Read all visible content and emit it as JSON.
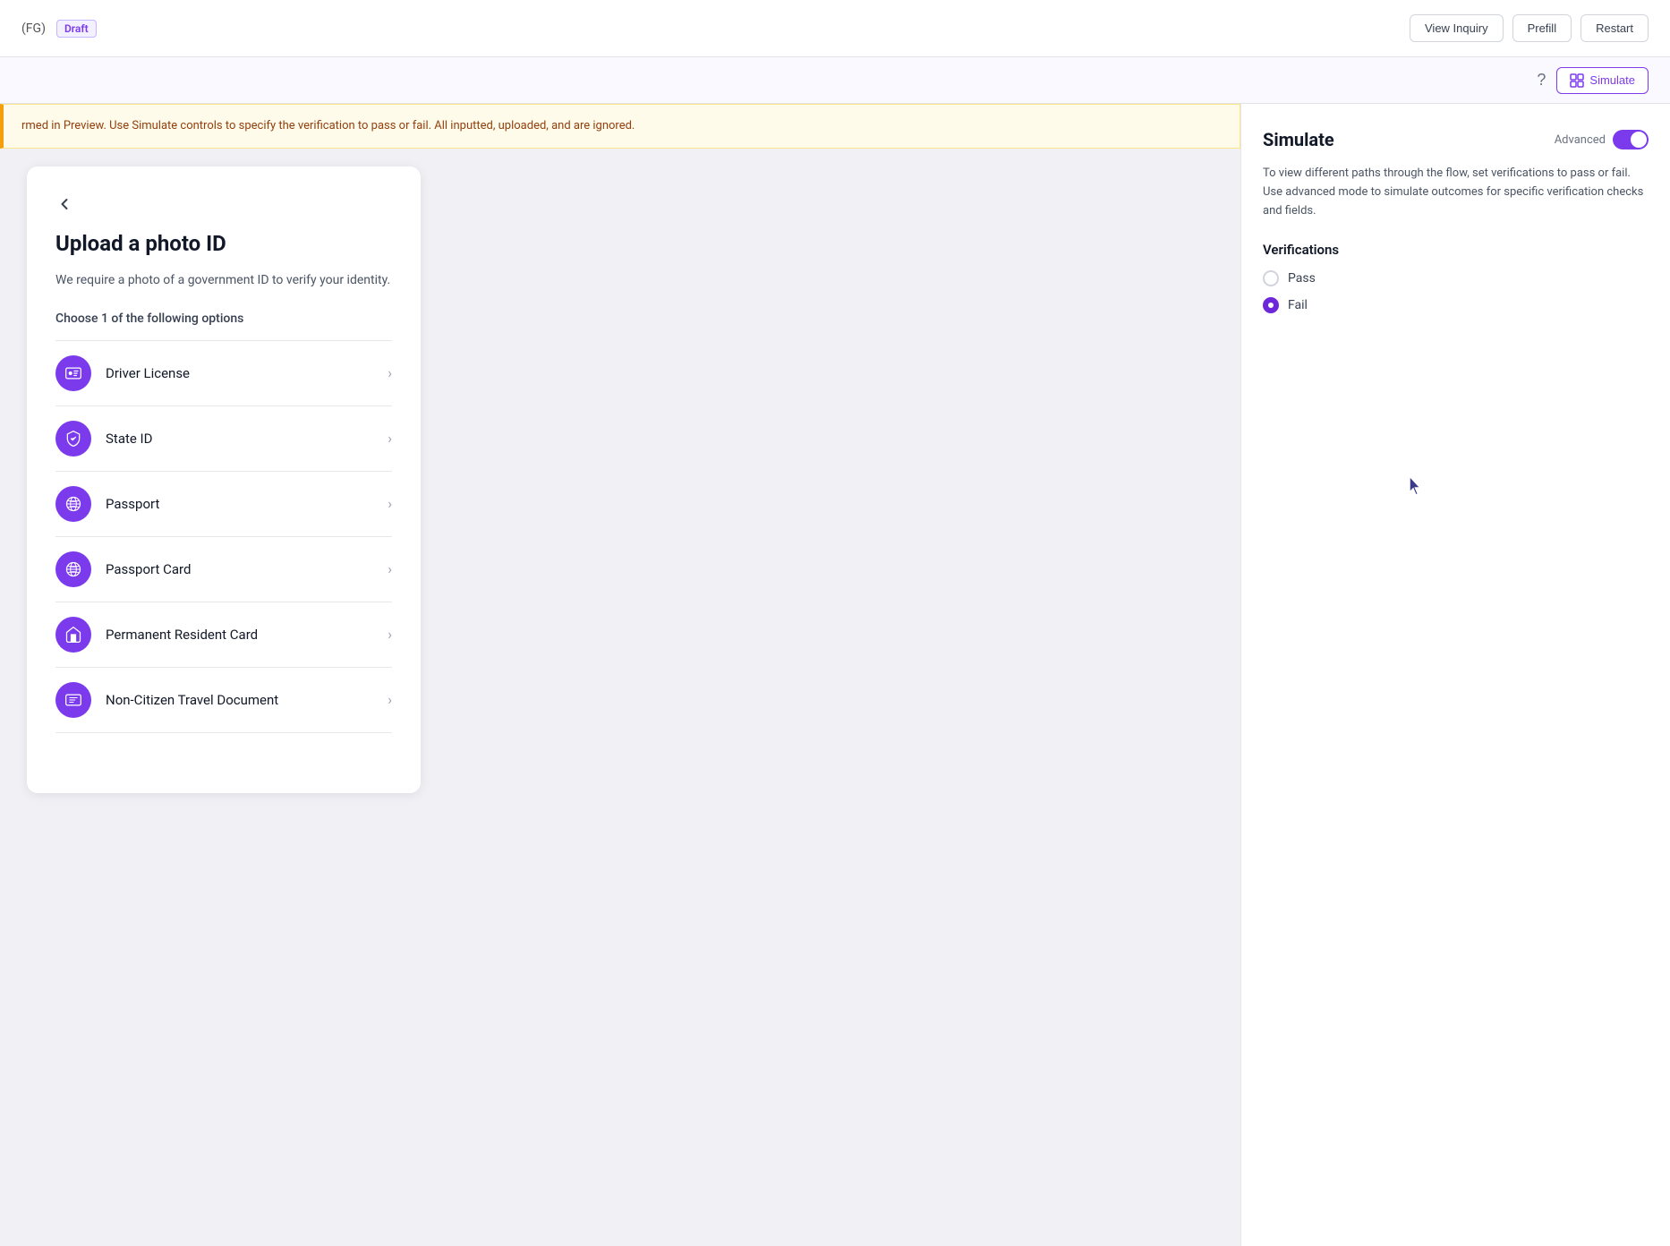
{
  "header": {
    "title": "(FG)",
    "draft_label": "Draft",
    "view_inquiry_label": "View Inquiry",
    "prefill_label": "Prefill",
    "restart_label": "Restart"
  },
  "toolbar": {
    "simulate_label": "Simulate",
    "help_icon": "?"
  },
  "warning": {
    "text": "rmed in Preview. Use Simulate controls to specify the verification to pass or fail. All inputted, uploaded, and\nare ignored."
  },
  "form": {
    "back_label": "‹",
    "title": "Upload a photo ID",
    "description": "We require a photo of a government ID to verify your identity.",
    "subtitle": "Choose 1 of the following options",
    "options": [
      {
        "id": "driver-license",
        "label": "Driver License",
        "icon": "card"
      },
      {
        "id": "state-id",
        "label": "State ID",
        "icon": "flag"
      },
      {
        "id": "passport",
        "label": "Passport",
        "icon": "globe"
      },
      {
        "id": "passport-card",
        "label": "Passport Card",
        "icon": "globe-alt"
      },
      {
        "id": "permanent-resident-card",
        "label": "Permanent Resident Card",
        "icon": "home"
      },
      {
        "id": "non-citizen-travel",
        "label": "Non-Citizen Travel Document",
        "icon": "card-alt"
      }
    ]
  },
  "simulate_panel": {
    "title": "Simulate",
    "advanced_label": "Advanced",
    "description": "To view different paths through the flow, set verifications to pass or fail. Use advanced mode to simulate outcomes for specific verification checks and fields.",
    "verifications_title": "Verifications",
    "pass_label": "Pass",
    "fail_label": "Fail",
    "selected": "fail"
  },
  "colors": {
    "accent": "#7c3aed",
    "accent_light": "#f3f0ff"
  }
}
